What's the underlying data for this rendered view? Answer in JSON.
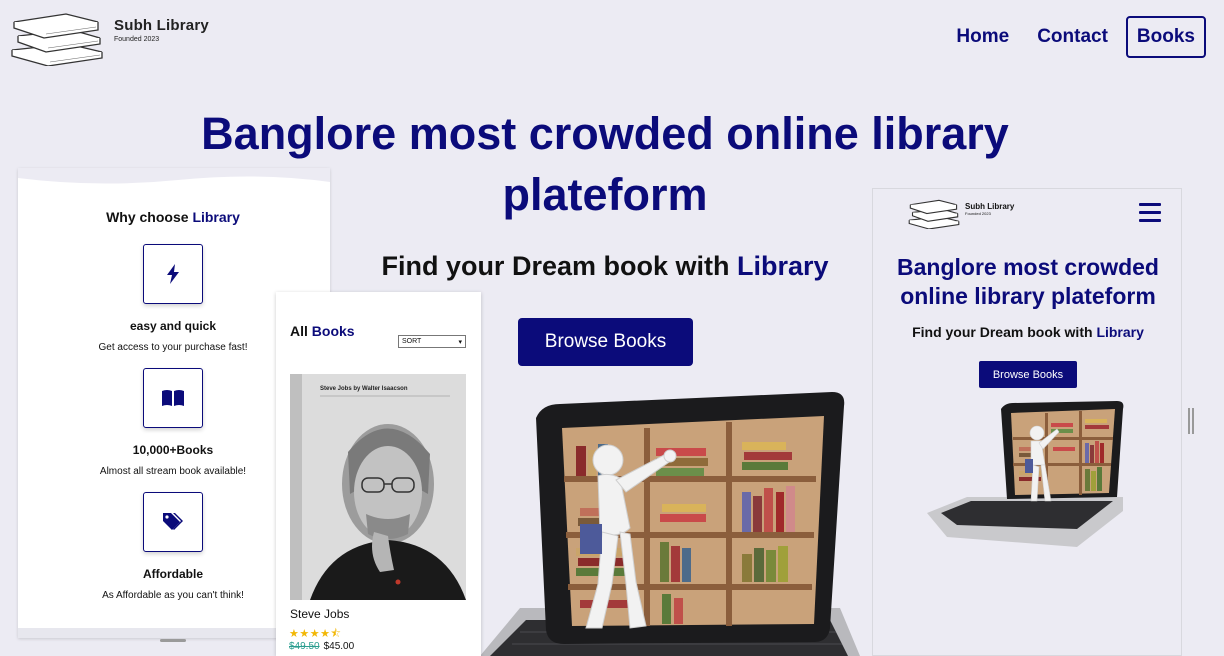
{
  "header": {
    "logo_name": "Subh Library",
    "logo_sub": "Founded 2023",
    "nav": [
      {
        "label": "Home",
        "active": false
      },
      {
        "label": "Contact",
        "active": false
      },
      {
        "label": "Books",
        "active": true
      }
    ]
  },
  "hero": {
    "title": "Banglore most crowded online library plateform",
    "subtitle_prefix": "Find your Dream book with ",
    "subtitle_accent": "Library",
    "button": "Browse Books"
  },
  "why": {
    "title_prefix": "Why choose ",
    "title_accent": "Library",
    "features": [
      {
        "icon": "lightning-icon",
        "title": "easy and quick",
        "desc": "Get access to your purchase fast!"
      },
      {
        "icon": "book-open-icon",
        "title": "10,000+Books",
        "desc": "Almost all stream book available!"
      },
      {
        "icon": "tag-icon",
        "title": "Affordable",
        "desc": "As Affordable as you can't think!"
      }
    ]
  },
  "books": {
    "title_prefix": "All ",
    "title_accent": "Books",
    "sort_selected": "SORT",
    "items": [
      {
        "name": "Steve Jobs",
        "cover_header": "Steve Jobs by Walter Isaacson",
        "rating": 4.5,
        "stars": "★★★★⯪",
        "price_old": "$49.50",
        "price_new": "$45.00"
      }
    ]
  },
  "mobile": {
    "logo_name": "Subh Library",
    "logo_sub": "Founded 2023",
    "title": "Banglore most crowded online library plateform",
    "subtitle_prefix": "Find your Dream book with ",
    "subtitle_accent": "Library",
    "button": "Browse Books"
  },
  "colors": {
    "accent": "#0b0b7a",
    "background": "#ecebf3",
    "star": "#f2b705",
    "old_price": "#2a9d8f"
  }
}
